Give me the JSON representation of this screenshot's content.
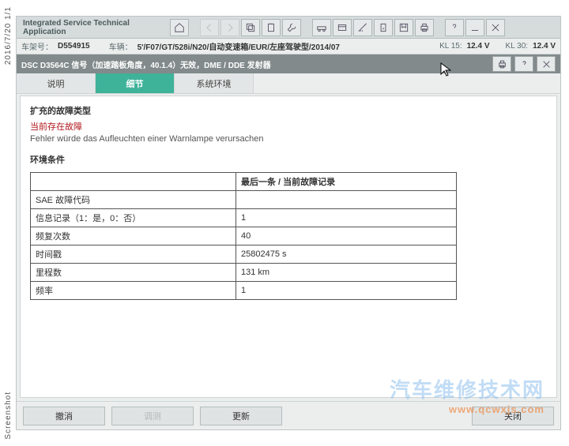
{
  "leftRail": {
    "top": "2016/7/20  1/1",
    "bottom": "Screenshot"
  },
  "appTitle": "Integrated Service Technical\nApplication",
  "infobar": {
    "chassisLabel": "车架号：",
    "chassis": "D554915",
    "vehicleLabel": "车辆：",
    "vehicle": "5'/F07/GT/528i/N20/自动变速箱/EUR/左座驾驶型/2014/07",
    "kl15Label": "KL 15:",
    "kl15": "12.4 V",
    "kl30Label": "KL 30:",
    "kl30": "12.4 V"
  },
  "subheader": "DSC D3564C 信号（加速踏板角度，40.1.4）无效，DME / DDE 发射器",
  "tabs": {
    "t0": "说明",
    "t1": "细节",
    "t2": "系统环境"
  },
  "fault": {
    "sectionTitle": "扩充的故障类型",
    "line1": "当前存在故障",
    "line2": "Fehler würde das Aufleuchten einer Warnlampe verursachen"
  },
  "env": {
    "title": "环境条件",
    "colHeader": "最后一条 / 当前故障记录",
    "rows": [
      {
        "k": "SAE 故障代码",
        "v": ""
      },
      {
        "k": "信息记录（1：是，0：否）",
        "v": "1"
      },
      {
        "k": "频复次数",
        "v": "40"
      },
      {
        "k": "时间戳",
        "v": "25802475 s"
      },
      {
        "k": "里程数",
        "v": "131 km"
      },
      {
        "k": "频率",
        "v": "1"
      }
    ]
  },
  "footer": {
    "b0": "撤消",
    "b1": "调测",
    "b2": "更新",
    "b3": "关闭"
  },
  "watermark": {
    "l1": "汽车维修技术网",
    "l2": "www.qcwxjs.com"
  }
}
